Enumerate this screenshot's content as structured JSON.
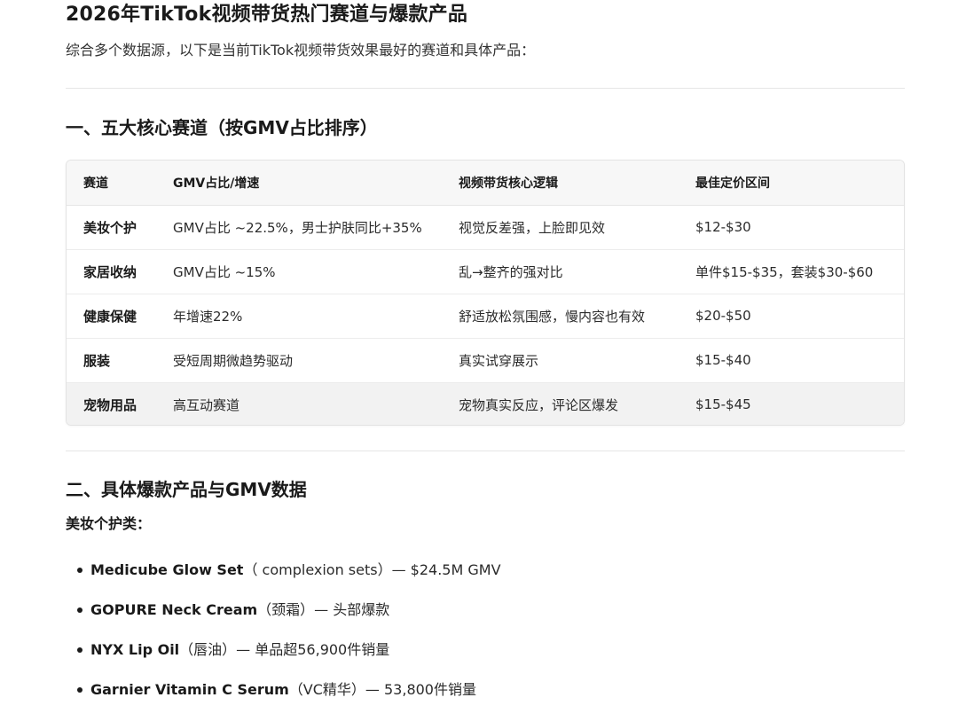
{
  "title": "2026年TikTok视频带货热门赛道与爆款产品",
  "intro": "综合多个数据源，以下是当前TikTok视频带货效果最好的赛道和具体产品：",
  "section1": {
    "heading": "一、五大核心赛道（按GMV占比排序）",
    "table": {
      "headers": [
        "赛道",
        "GMV占比/增速",
        "视频带货核心逻辑",
        "最佳定价区间"
      ],
      "rows": [
        [
          "美妆个护",
          "GMV占比 ~22.5%，男士护肤同比+35%",
          "视觉反差强，上脸即见效",
          "$12-$30"
        ],
        [
          "家居收纳",
          "GMV占比 ~15%",
          "乱→整齐的强对比",
          "单件$15-$35，套装$30-$60"
        ],
        [
          "健康保健",
          "年增速22%",
          "舒适放松氛围感，慢内容也有效",
          "$20-$50"
        ],
        [
          "服装",
          "受短周期微趋势驱动",
          "真实试穿展示",
          "$15-$40"
        ],
        [
          "宠物用品",
          "高互动赛道",
          "宠物真实反应，评论区爆发",
          "$15-$45"
        ]
      ]
    }
  },
  "section2": {
    "heading": "二、具体爆款产品与GMV数据",
    "subhead": "美妆个护类：",
    "products": [
      {
        "name": "Medicube Glow Set",
        "detail": "（ complexion sets）— $24.5M GMV"
      },
      {
        "name": "GOPURE Neck Cream",
        "detail": "（颈霜）— 头部爆款"
      },
      {
        "name": "NYX Lip Oil",
        "detail": "（唇油）— 单品超56,900件销量"
      },
      {
        "name": "Garnier Vitamin C Serum",
        "detail": "（VC精华）— 53,800件销量"
      }
    ]
  }
}
